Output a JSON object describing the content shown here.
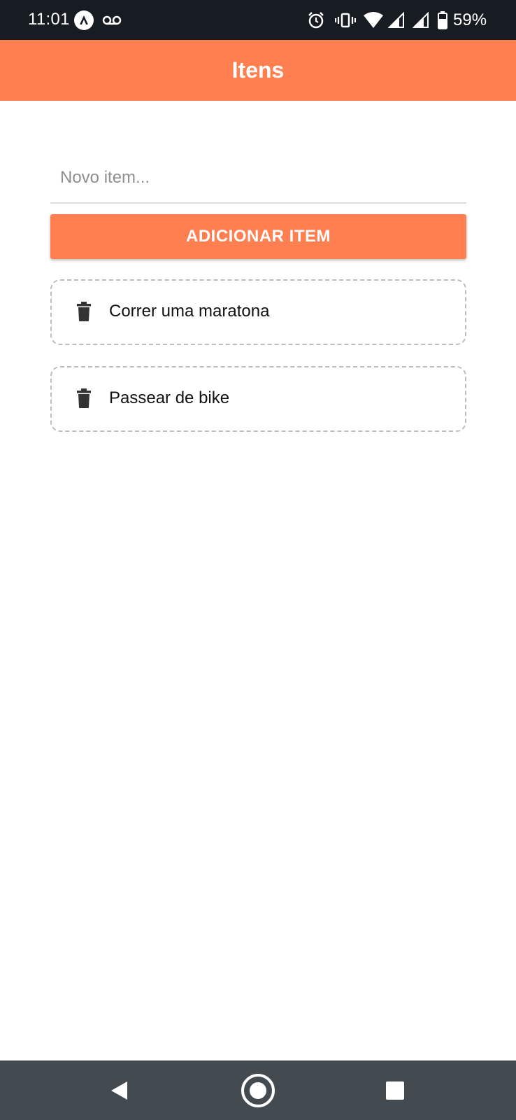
{
  "status_bar": {
    "time": "11:01",
    "battery_percent": "59%",
    "icons": [
      "app-notification-icon",
      "voicemail-icon",
      "alarm-icon",
      "vibrate-icon",
      "wifi-icon",
      "signal-icon",
      "signal-icon",
      "battery-icon"
    ]
  },
  "app_bar": {
    "title": "Itens",
    "color": "#ff7f50"
  },
  "form": {
    "input_placeholder": "Novo item...",
    "input_value": "",
    "add_button_label": "ADICIONAR ITEM"
  },
  "items": [
    {
      "label": "Correr uma maratona",
      "icon": "trash-icon"
    },
    {
      "label": "Passear de bike",
      "icon": "trash-icon"
    }
  ],
  "nav_bar": {
    "buttons": [
      "back-icon",
      "home-icon",
      "recents-icon"
    ]
  }
}
